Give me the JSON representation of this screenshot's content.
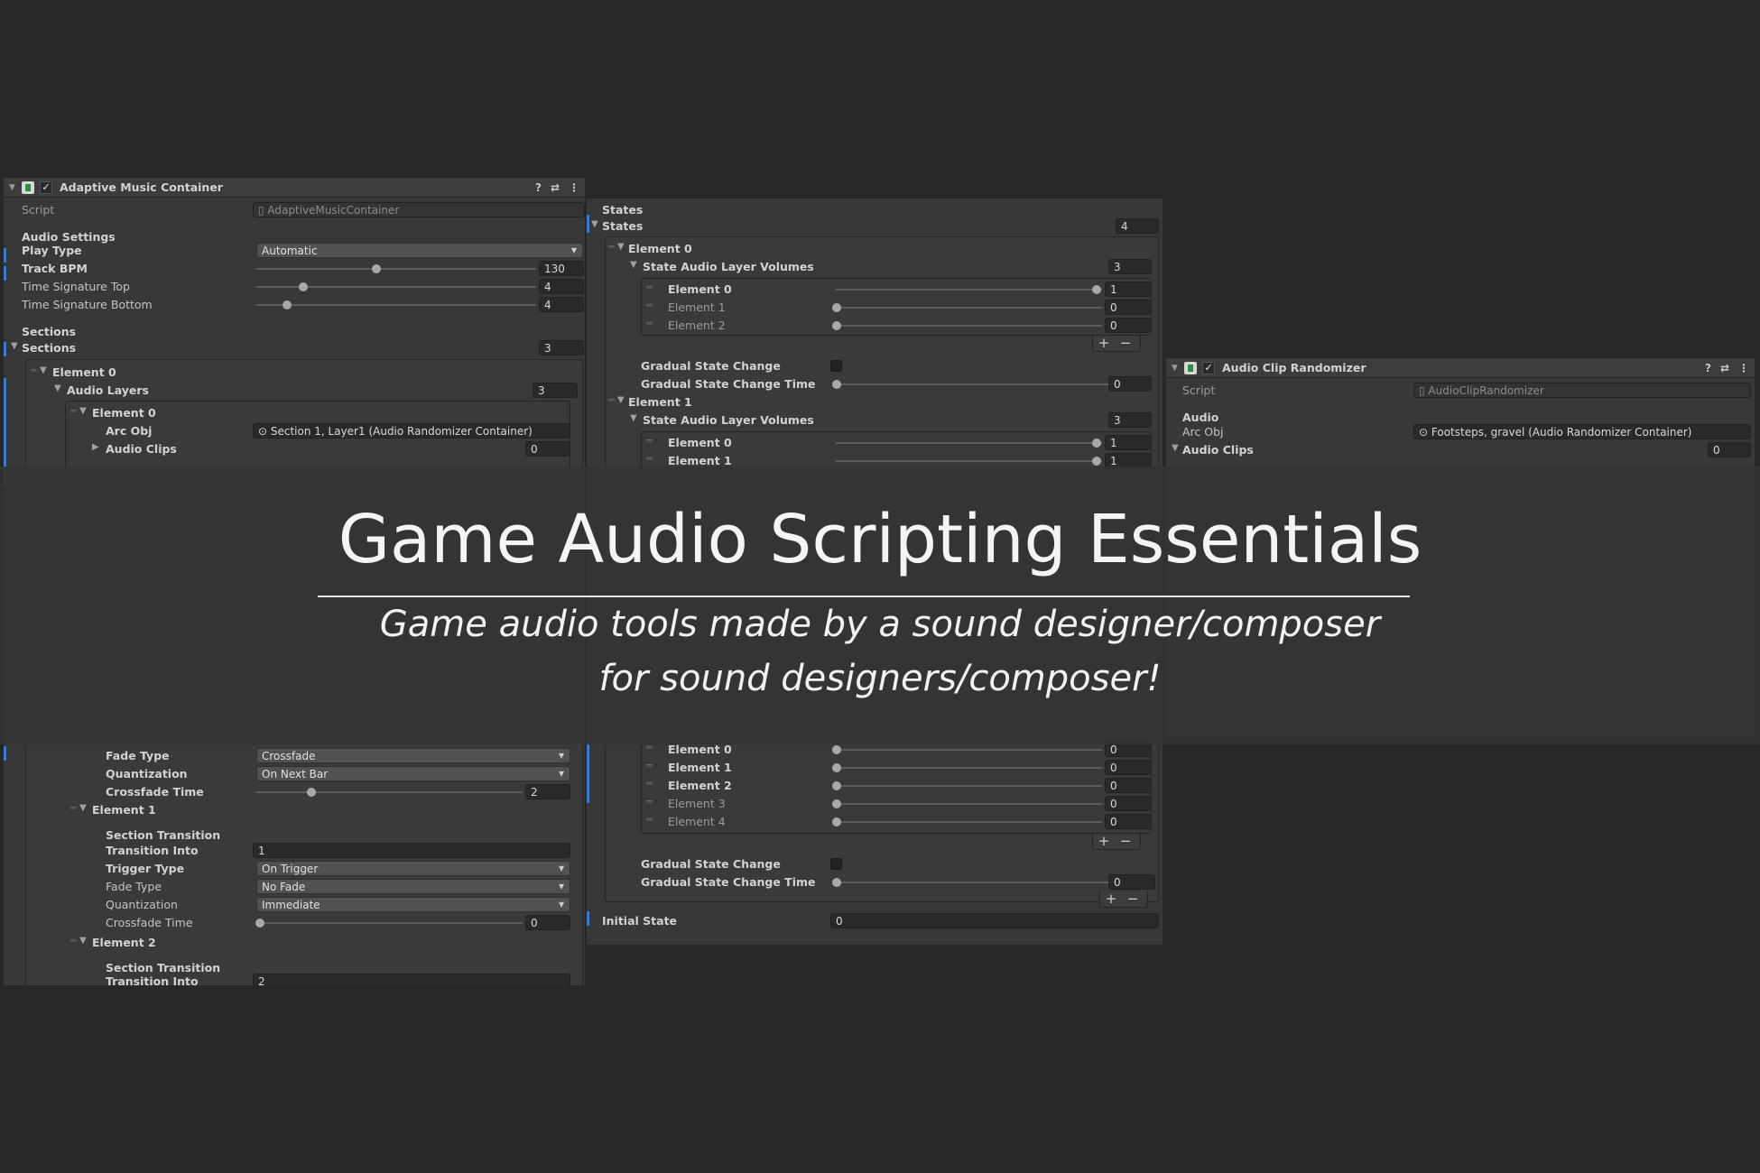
{
  "left_panel": {
    "title": "Adaptive Music Container",
    "script_label": "Script",
    "script_value": "AdaptiveMusicContainer",
    "audio_settings_header": "Audio Settings",
    "play_type_label": "Play Type",
    "play_type_value": "Automatic",
    "track_bpm_label": "Track BPM",
    "track_bpm_value": "130",
    "ts_top_label": "Time Signature Top",
    "ts_top_value": "4",
    "ts_bottom_label": "Time Signature Bottom",
    "ts_bottom_value": "4",
    "sections_header": "Sections",
    "sections_label": "Sections",
    "sections_count": "3",
    "element0_label": "Element 0",
    "audio_layers_label": "Audio Layers",
    "audio_layers_count": "3",
    "layer0_label": "Element 0",
    "arc_obj_label": "Arc Obj",
    "arc_obj_value": "Section 1, Layer1 (Audio Randomizer Container)",
    "audio_clips_label": "Audio Clips",
    "audio_clips_count": "0",
    "fade_type_label": "Fade Type",
    "fade_type_value": "Crossfade",
    "quantization_label": "Quantization",
    "quantization_value": "On Next Bar",
    "crossfade_time_label": "Crossfade Time",
    "crossfade_time_value": "2",
    "st_element1_label": "Element 1",
    "section_transition_label": "Section Transition",
    "transition_into_label": "Transition Into",
    "transition_into_value": "1",
    "trigger_type_label": "Trigger Type",
    "trigger_type_value": "On Trigger",
    "fade_type2_label": "Fade Type",
    "fade_type2_value": "No Fade",
    "quantization2_label": "Quantization",
    "quantization2_value": "Immediate",
    "crossfade_time2_label": "Crossfade Time",
    "crossfade_time2_value": "0",
    "st_element2_label": "Element 2",
    "section_transition2_label": "Section Transition",
    "transition_into2_label": "Transition Into",
    "transition_into2_value": "2"
  },
  "middle_panel": {
    "states_header": "States",
    "states_label": "States",
    "states_count": "4",
    "state0": {
      "label": "Element 0",
      "volumes_label": "State Audio Layer Volumes",
      "volumes_count": "3",
      "items": [
        {
          "label": "Element 0",
          "value": "1"
        },
        {
          "label": "Element 1",
          "value": "0"
        },
        {
          "label": "Element 2",
          "value": "0"
        }
      ],
      "gradual_label": "Gradual State Change",
      "gradual_time_label": "Gradual State Change Time",
      "gradual_time_value": "0"
    },
    "state1": {
      "label": "Element 1",
      "volumes_label": "State Audio Layer Volumes",
      "volumes_count": "3",
      "items": [
        {
          "label": "Element 0",
          "value": "1"
        },
        {
          "label": "Element 1",
          "value": "1"
        }
      ]
    },
    "state3": {
      "items": [
        {
          "label": "Element 0",
          "value": "0"
        },
        {
          "label": "Element 1",
          "value": "0"
        },
        {
          "label": "Element 2",
          "value": "0"
        },
        {
          "label": "Element 3",
          "value": "0"
        },
        {
          "label": "Element 4",
          "value": "0"
        }
      ],
      "gradual_label": "Gradual State Change",
      "gradual_time_label": "Gradual State Change Time",
      "gradual_time_value": "0"
    },
    "plus": "+",
    "minus": "−",
    "initial_state_label": "Initial State",
    "initial_state_value": "0"
  },
  "right_panel": {
    "title": "Audio Clip Randomizer",
    "script_label": "Script",
    "script_value": "AudioClipRandomizer",
    "audio_header": "Audio",
    "arc_obj_label": "Arc Obj",
    "arc_obj_value": "Footsteps, gravel (Audio Randomizer Container)",
    "audio_clips_label": "Audio Clips",
    "audio_clips_count": "0"
  },
  "banner": {
    "title": "Game Audio Scripting Essentials",
    "subtitle_line1": "Game audio tools made by a sound designer/composer",
    "subtitle_line2": "for sound designers/composer!"
  },
  "colors": {
    "background": "#282828",
    "panel": "#383838",
    "accent_blue": "#3a7ac8"
  }
}
